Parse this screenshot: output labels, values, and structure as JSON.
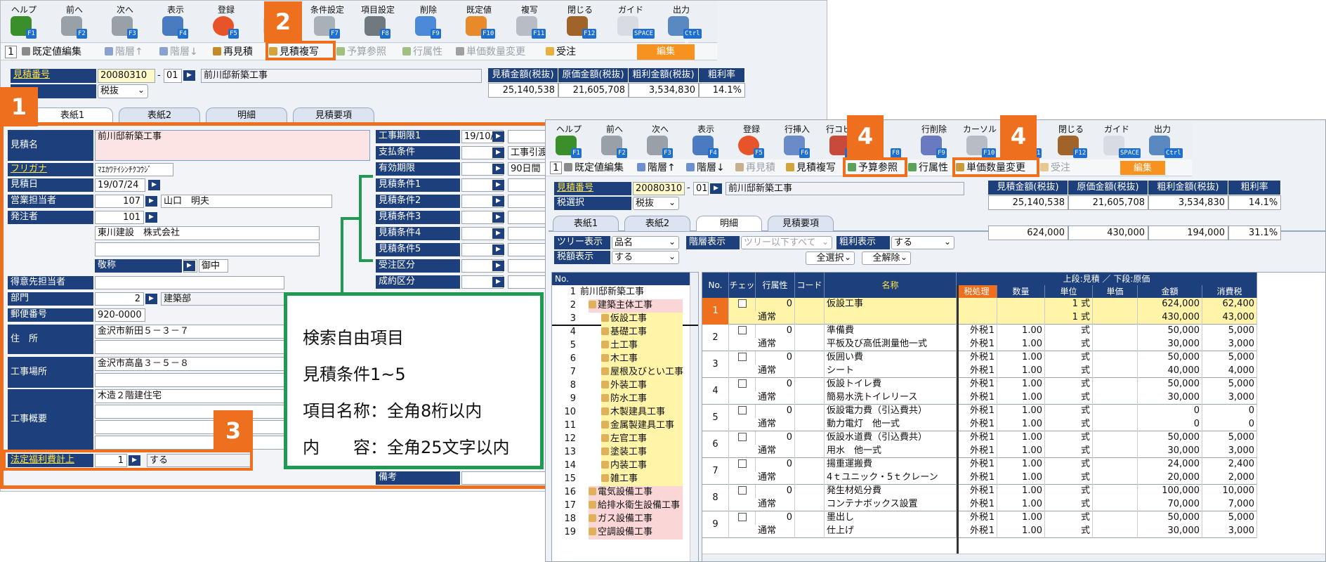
{
  "colors": {
    "accent": "#ee6f1e",
    "callout": "#1f9a52",
    "label_bg": "#1d3f7c",
    "edit": "#f7921e"
  },
  "left": {
    "toolbar": [
      {
        "label": "ヘルプ",
        "fkey": "F1",
        "icon": "question-icon"
      },
      {
        "label": "前へ",
        "fkey": "F2",
        "icon": "arrow-left-icon"
      },
      {
        "label": "次へ",
        "fkey": "F3",
        "icon": "arrow-right-icon"
      },
      {
        "label": "表示",
        "fkey": "F4",
        "icon": "magnifier-icon"
      },
      {
        "label": "登録",
        "fkey": "F5",
        "icon": "ok-icon"
      },
      {
        "label": "",
        "fkey": "F6",
        "icon": "insert-icon"
      },
      {
        "label": "条件設定",
        "fkey": "F7",
        "icon": "search-settings-icon"
      },
      {
        "label": "項目設定",
        "fkey": "F8",
        "icon": "gear-icon"
      },
      {
        "label": "削除",
        "fkey": "F9",
        "icon": "trash-icon"
      },
      {
        "label": "既定値",
        "fkey": "F10",
        "icon": "refresh-icon"
      },
      {
        "label": "複写",
        "fkey": "F11",
        "icon": "copy-icon"
      },
      {
        "label": "閉じる",
        "fkey": "F12",
        "icon": "door-icon"
      },
      {
        "label": "ガイド",
        "fkey": "SPACE",
        "icon": "bulb-icon"
      },
      {
        "label": "出力",
        "fkey": "Ctrl P",
        "icon": "output-icon"
      }
    ],
    "subbar": {
      "num": "1",
      "default_edit": "既定値編集",
      "level_up": "階層↑",
      "level_down": "階層↓",
      "re_estimate": "再見積",
      "copy_estimate": "見積複写",
      "budget_ref": "予算参照",
      "row_attr": "行属性",
      "unit_qty_change": "単価数量変更",
      "order": "受注",
      "edit": "編集"
    },
    "header": {
      "estimate_no_label": "見積番号",
      "estimate_no": "20080310",
      "suffix": "01",
      "project_name": "前川邸新築工事",
      "tax": "税抜"
    },
    "amounts": {
      "headers": [
        "見積金額(税抜)",
        "原価金額(税抜)",
        "粗利金額(税抜)",
        "粗利率"
      ],
      "values": [
        "25,140,538",
        "21,605,708",
        "3,534,830",
        "14.1%"
      ]
    },
    "tabs": [
      "表紙1",
      "表紙2",
      "明細",
      "見積要項"
    ],
    "form": {
      "name_label": "見積名",
      "name": "前川邸新築工事",
      "kana_label": "フリガナ",
      "kana": "ﾏｴｶﾜﾃｲｼﾝﾁｸｺｳｼﾞ",
      "date_label": "見積日",
      "date": "19/07/24",
      "sales_label": "営業担当者",
      "sales_code": "107",
      "sales_name": "山口　明夫",
      "client_label": "発注者",
      "client_code": "101",
      "client_name": "東川建設　株式会社",
      "honorific_label": "敬称",
      "honorific": "御中",
      "contact_label": "得意先担当者",
      "dept_label": "部門",
      "dept_code": "2",
      "dept_name": "建築部",
      "zip_label": "郵便番号",
      "zip": "920-0000",
      "addr_label": "住　所",
      "addr": "金沢市新田５－３－７",
      "site_label": "工事場所",
      "site": "金沢市高畠３－５－８",
      "summary_label": "工事概要",
      "summary": "木造２階建住宅",
      "welfare_label": "法定福利費計上",
      "welfare_code": "1",
      "welfare_value": "する"
    },
    "right_fields": [
      {
        "label": "工事期限1",
        "value": "19/10/21",
        "extra": ""
      },
      {
        "label": "支払条件",
        "value": "",
        "extra": "工事引渡"
      },
      {
        "label": "有効期限",
        "value": "",
        "extra": "90日間"
      },
      {
        "label": "見積条件1",
        "value": "",
        "extra": ""
      },
      {
        "label": "見積条件2",
        "value": "",
        "extra": ""
      },
      {
        "label": "見積条件3",
        "value": "",
        "extra": ""
      },
      {
        "label": "見積条件4",
        "value": "",
        "extra": ""
      },
      {
        "label": "見積条件5",
        "value": "",
        "extra": ""
      },
      {
        "label": "受注区分",
        "value": "",
        "extra": ""
      },
      {
        "label": "成約区分",
        "value": "",
        "extra": ""
      }
    ],
    "remarks_label": "備考"
  },
  "callout": {
    "lines": [
      "検索自由項目",
      "見積条件1~5",
      "項目名称：全角8桁以内",
      "内　　容：全角25文字以内"
    ]
  },
  "badges": [
    "1",
    "2",
    "3",
    "4",
    "4"
  ],
  "right": {
    "toolbar": [
      {
        "label": "ヘルプ",
        "fkey": "F1",
        "icon": "question-icon"
      },
      {
        "label": "前へ",
        "fkey": "F2",
        "icon": "arrow-left-icon"
      },
      {
        "label": "次へ",
        "fkey": "F3",
        "icon": "arrow-right-icon"
      },
      {
        "label": "表示",
        "fkey": "F4",
        "icon": "magnifier-icon"
      },
      {
        "label": "登録",
        "fkey": "F5",
        "icon": "ok-icon"
      },
      {
        "label": "行挿入",
        "fkey": "F6",
        "icon": "row-insert-icon"
      },
      {
        "label": "行コピー",
        "fkey": "F7",
        "icon": "row-copy-icon"
      },
      {
        "label": "",
        "fkey": "F8",
        "icon": "blank-icon"
      },
      {
        "label": "行削除",
        "fkey": "F9",
        "icon": "row-delete-icon"
      },
      {
        "label": "カーソル",
        "fkey": "F10",
        "icon": "cursor-icon"
      },
      {
        "label": "削除",
        "fkey": "F11",
        "icon": "trash-icon"
      },
      {
        "label": "閉じる",
        "fkey": "F12",
        "icon": "door-icon"
      },
      {
        "label": "ガイド",
        "fkey": "SPACE",
        "icon": "bulb-icon"
      },
      {
        "label": "出力",
        "fkey": "Ctrl P",
        "icon": "output-icon"
      }
    ],
    "subbar": {
      "num": "1",
      "default_edit": "既定値編集",
      "level_up": "階層↑",
      "level_down": "階層↓",
      "re_estimate": "再見積",
      "copy_estimate": "見積複写",
      "budget_ref": "予算参照",
      "row_attr": "行属性",
      "unit_qty_change": "単価数量変更",
      "order": "受注",
      "edit": "編集"
    },
    "header": {
      "estimate_no_label": "見積番号",
      "estimate_no": "20080310",
      "suffix": "01",
      "project_name": "前川邸新築工事",
      "tax_label": "税選択",
      "tax": "税抜"
    },
    "amounts": {
      "headers": [
        "見積金額(税抜)",
        "原価金額(税抜)",
        "粗利金額(税抜)",
        "粗利率"
      ],
      "values": [
        "25,140,538",
        "21,605,708",
        "3,534,830",
        "14.1%"
      ],
      "sub": [
        "624,000",
        "430,000",
        "194,000",
        "31.1%"
      ]
    },
    "tabs": [
      "表紙1",
      "表紙2",
      "明細",
      "見積要項"
    ],
    "filters": {
      "tree_label": "ツリー表示",
      "tree_value": "品名",
      "tax_label": "税額表示",
      "tax_value": "する",
      "level_label": "階層表示",
      "level_value": "ツリー以下すべて",
      "gross_label": "粗利表示",
      "gross_value": "する",
      "select_all": "全選択",
      "deselect_all": "全解除"
    },
    "tree_header": "No.",
    "tree": [
      {
        "n": "1",
        "t": "前川邸新築工事",
        "lv": 0,
        "c": ""
      },
      {
        "n": "2",
        "t": "建築主体工事",
        "lv": 1,
        "c": "pk"
      },
      {
        "n": "3",
        "t": "仮設工事",
        "lv": 2,
        "c": "yl"
      },
      {
        "n": "4",
        "t": "基礎工事",
        "lv": 2,
        "c": "yl"
      },
      {
        "n": "5",
        "t": "土工事",
        "lv": 2,
        "c": "yl"
      },
      {
        "n": "6",
        "t": "木工事",
        "lv": 2,
        "c": "yl"
      },
      {
        "n": "7",
        "t": "屋根及びとい工事",
        "lv": 2,
        "c": "yl"
      },
      {
        "n": "8",
        "t": "外装工事",
        "lv": 2,
        "c": "yl"
      },
      {
        "n": "9",
        "t": "防水工事",
        "lv": 2,
        "c": "yl"
      },
      {
        "n": "10",
        "t": "木製建具工事",
        "lv": 2,
        "c": "yl"
      },
      {
        "n": "11",
        "t": "金属製建具工事",
        "lv": 2,
        "c": "yl"
      },
      {
        "n": "12",
        "t": "左官工事",
        "lv": 2,
        "c": "yl"
      },
      {
        "n": "13",
        "t": "塗装工事",
        "lv": 2,
        "c": "yl"
      },
      {
        "n": "14",
        "t": "内装工事",
        "lv": 2,
        "c": "yl"
      },
      {
        "n": "15",
        "t": "雑工事",
        "lv": 2,
        "c": "yl"
      },
      {
        "n": "16",
        "t": "電気設備工事",
        "lv": 1,
        "c": "pk"
      },
      {
        "n": "17",
        "t": "給排水衛生設備工事",
        "lv": 1,
        "c": "pk"
      },
      {
        "n": "18",
        "t": "ガス設備工事",
        "lv": 1,
        "c": "pk"
      },
      {
        "n": "19",
        "t": "空調設備工事",
        "lv": 1,
        "c": "pk"
      }
    ],
    "grid": {
      "top_caption": "上段:見積 ／ 下段:原価",
      "headers": [
        "No.",
        "チェック",
        "行属性",
        "コード",
        "名称",
        "税処理",
        "数量",
        "単位",
        "単価",
        "金額",
        "消費税"
      ],
      "rows": [
        {
          "no": "1",
          "attr": "0",
          "attr2": "通常",
          "name": "仮設工事",
          "name2": "",
          "tax": "",
          "tax2": "",
          "qty": "",
          "qty2": "",
          "unit": "1 式",
          "unit2": "1 式",
          "price": "",
          "price2": "",
          "amt": "624,000",
          "amt2": "430,000",
          "ctax": "62,400",
          "ctax2": "43,000",
          "hl": true
        },
        {
          "no": "2",
          "attr": "0",
          "attr2": "通常",
          "name": "準備費",
          "name2": "平板及び高低測量他一式",
          "tax": "1",
          "tax2": "1",
          "qty": "1.00",
          "qty2": "1.00",
          "unit": "式",
          "unit2": "式",
          "price": "",
          "price2": "",
          "amt": "50,000",
          "amt2": "30,000",
          "ctax": "5,000",
          "ctax2": "3,000",
          "hl": false
        },
        {
          "no": "3",
          "attr": "0",
          "attr2": "通常",
          "name": "仮囲い費",
          "name2": "シート",
          "tax": "1",
          "tax2": "1",
          "qty": "1.00",
          "qty2": "1.00",
          "unit": "式",
          "unit2": "式",
          "price": "",
          "price2": "",
          "amt": "50,000",
          "amt2": "40,000",
          "ctax": "5,000",
          "ctax2": "4,000",
          "hl": false
        },
        {
          "no": "4",
          "attr": "0",
          "attr2": "通常",
          "name": "仮設トイレ費",
          "name2": "簡易水洗トイレリース",
          "tax": "1",
          "tax2": "1",
          "qty": "1.00",
          "qty2": "1.00",
          "unit": "式",
          "unit2": "式",
          "price": "",
          "price2": "",
          "amt": "50,000",
          "amt2": "30,000",
          "ctax": "5,000",
          "ctax2": "3,000",
          "hl": false
        },
        {
          "no": "5",
          "attr": "0",
          "attr2": "通常",
          "name": "仮設電力費（引込費共）",
          "name2": "動力電灯　他一式",
          "tax": "1",
          "tax2": "1",
          "qty": "1.00",
          "qty2": "1.00",
          "unit": "式",
          "unit2": "式",
          "price": "",
          "price2": "",
          "amt": "0",
          "amt2": "0",
          "ctax": "0",
          "ctax2": "0",
          "hl": false
        },
        {
          "no": "6",
          "attr": "0",
          "attr2": "通常",
          "name": "仮設水道費（引込費共）",
          "name2": "用水　他一式",
          "tax": "1",
          "tax2": "1",
          "qty": "1.00",
          "qty2": "1.00",
          "unit": "式",
          "unit2": "式",
          "price": "",
          "price2": "",
          "amt": "50,000",
          "amt2": "30,000",
          "ctax": "5,000",
          "ctax2": "3,000",
          "hl": false
        },
        {
          "no": "7",
          "attr": "0",
          "attr2": "通常",
          "name": "揚重運搬費",
          "name2": "4ｔユニック・5ｔクレーン",
          "tax": "1",
          "tax2": "1",
          "qty": "1.00",
          "qty2": "1.00",
          "unit": "式",
          "unit2": "式",
          "price": "",
          "price2": "",
          "amt": "24,000",
          "amt2": "20,000",
          "ctax": "2,400",
          "ctax2": "2,000",
          "hl": false
        },
        {
          "no": "8",
          "attr": "0",
          "attr2": "通常",
          "name": "発生材処分費",
          "name2": "コンテナボックス設置",
          "tax": "1",
          "tax2": "1",
          "qty": "1.00",
          "qty2": "1.00",
          "unit": "式",
          "unit2": "式",
          "price": "",
          "price2": "",
          "amt": "100,000",
          "amt2": "70,000",
          "ctax": "10,000",
          "ctax2": "7,000",
          "hl": false
        },
        {
          "no": "9",
          "attr": "0",
          "attr2": "通常",
          "name": "墨出し",
          "name2": "仕上げ",
          "tax": "1",
          "tax2": "1",
          "qty": "1.00",
          "qty2": "1.00",
          "unit": "式",
          "unit2": "式",
          "price": "",
          "price2": "",
          "amt": "50,000",
          "amt2": "30,000",
          "ctax": "5,000",
          "ctax2": "3,000",
          "hl": false
        }
      ],
      "tax_text": "外税"
    }
  }
}
